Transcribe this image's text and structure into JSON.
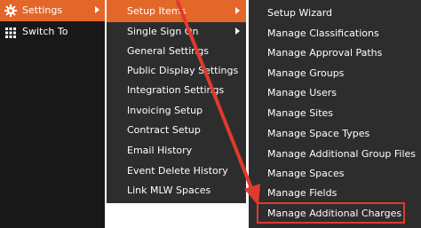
{
  "main_menu": {
    "items": [
      {
        "label": "Settings",
        "icon": "gear-icon"
      },
      {
        "label": "Switch To",
        "icon": "grid-icon"
      }
    ]
  },
  "setup_menu": {
    "items": [
      {
        "label": "Setup Items"
      },
      {
        "label": "Single Sign On"
      },
      {
        "label": "General Settings"
      },
      {
        "label": "Public Display Settings"
      },
      {
        "label": "Integration Settings"
      },
      {
        "label": "Invoicing Setup"
      },
      {
        "label": "Contract Setup"
      },
      {
        "label": "Email History"
      },
      {
        "label": "Event Delete History"
      },
      {
        "label": "Link MLW Spaces"
      }
    ]
  },
  "setup_items_menu": {
    "items": [
      {
        "label": "Setup Wizard"
      },
      {
        "label": "Manage Classifications"
      },
      {
        "label": "Manage Approval Paths"
      },
      {
        "label": "Manage Groups"
      },
      {
        "label": "Manage Users"
      },
      {
        "label": "Manage Sites"
      },
      {
        "label": "Manage Space Types"
      },
      {
        "label": "Manage Additional Group Files"
      },
      {
        "label": "Manage Spaces"
      },
      {
        "label": "Manage Fields"
      },
      {
        "label": "Manage Additional Charges"
      }
    ]
  },
  "colors": {
    "accent": "#e4672a",
    "menu_bg": "#2d2d2d",
    "main_bg": "#181818",
    "annotation": "#e03a2e"
  }
}
